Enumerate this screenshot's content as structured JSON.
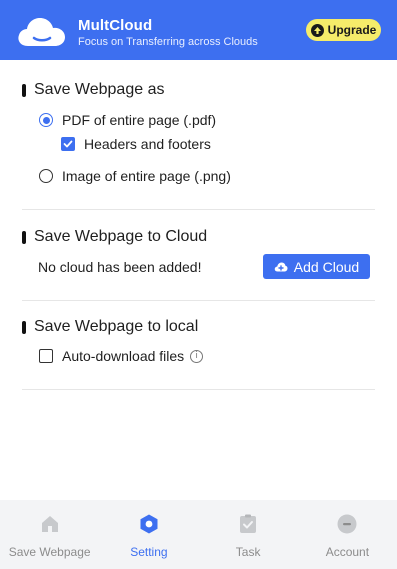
{
  "header": {
    "brand": "MultCloud",
    "tagline": "Focus on Transferring across Clouds",
    "upgrade_label": "Upgrade"
  },
  "save_as": {
    "title": "Save Webpage as",
    "pdf_label": "PDF of entire page (.pdf)",
    "headers_label": "Headers and footers",
    "png_label": "Image of entire page (.png)",
    "selected": "pdf",
    "headers_checked": true
  },
  "to_cloud": {
    "title": "Save Webpage to Cloud",
    "empty_text": "No cloud has been added!",
    "add_label": "Add Cloud"
  },
  "to_local": {
    "title": "Save Webpage to local",
    "auto_label": "Auto-download files",
    "auto_checked": false
  },
  "nav": {
    "items": [
      {
        "label": "Save Webpage",
        "icon": "home-icon"
      },
      {
        "label": "Setting",
        "icon": "settings-hexagon-icon",
        "active": true
      },
      {
        "label": "Task",
        "icon": "task-check-icon"
      },
      {
        "label": "Account",
        "icon": "account-icon"
      }
    ]
  },
  "colors": {
    "accent": "#3d6ff0",
    "upgrade_bg": "#f5ec6a",
    "nav_bg": "#f3f4f6"
  }
}
